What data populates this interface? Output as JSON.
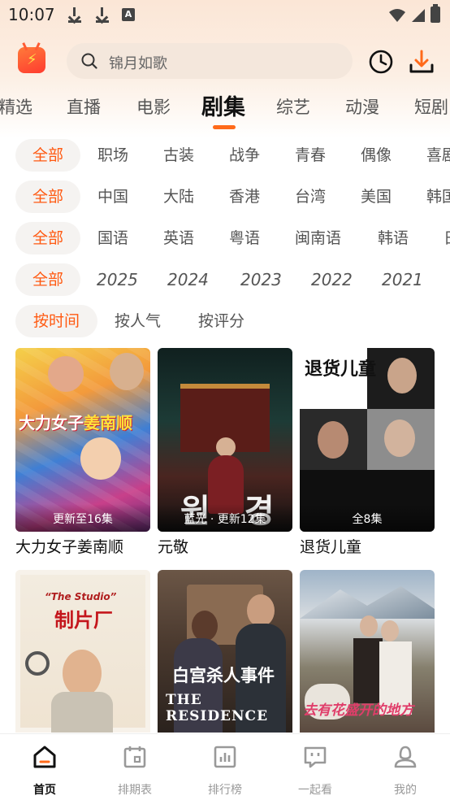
{
  "status_bar": {
    "time": "10:07"
  },
  "search": {
    "placeholder": "锦月如歌"
  },
  "category_tabs": [
    "精选",
    "直播",
    "电影",
    "剧集",
    "综艺",
    "动漫",
    "短剧"
  ],
  "active_tab": "剧集",
  "filters": {
    "genre": [
      "全部",
      "职场",
      "古装",
      "战争",
      "青春",
      "偶像",
      "喜剧"
    ],
    "region": [
      "全部",
      "中国",
      "大陆",
      "香港",
      "台湾",
      "美国",
      "韩国"
    ],
    "language": [
      "全部",
      "国语",
      "英语",
      "粤语",
      "闽南语",
      "韩语",
      "日"
    ],
    "year": [
      "全部",
      "2025",
      "2024",
      "2023",
      "2022",
      "2021"
    ],
    "sort": [
      "按时间",
      "按人气",
      "按评分"
    ]
  },
  "cards": [
    {
      "title": "大力女子姜南顺",
      "badge": "更新至16集",
      "poster_text": "大力女子姜南顺"
    },
    {
      "title": "元敬",
      "badge": "蓝光 · 更新12集",
      "poster_text": "원 경"
    },
    {
      "title": "退货儿童",
      "badge": "全8集",
      "poster_text": "退货儿童"
    },
    {
      "title": "",
      "badge": "",
      "poster_text": "制片厂",
      "poster_sub": "“The Studio”"
    },
    {
      "title": "",
      "badge": "",
      "poster_text": "白宫杀人事件",
      "poster_sub": "THE RESIDENCE"
    },
    {
      "title": "",
      "badge": "",
      "poster_text": "去有花盛开的地方"
    }
  ],
  "bottom_nav": [
    "首页",
    "排期表",
    "排行榜",
    "一起看",
    "我的"
  ],
  "colors": {
    "accent": "#ff6a1a",
    "selected_text": "#ff5a12",
    "chip_bg": "#f5f3f1"
  }
}
